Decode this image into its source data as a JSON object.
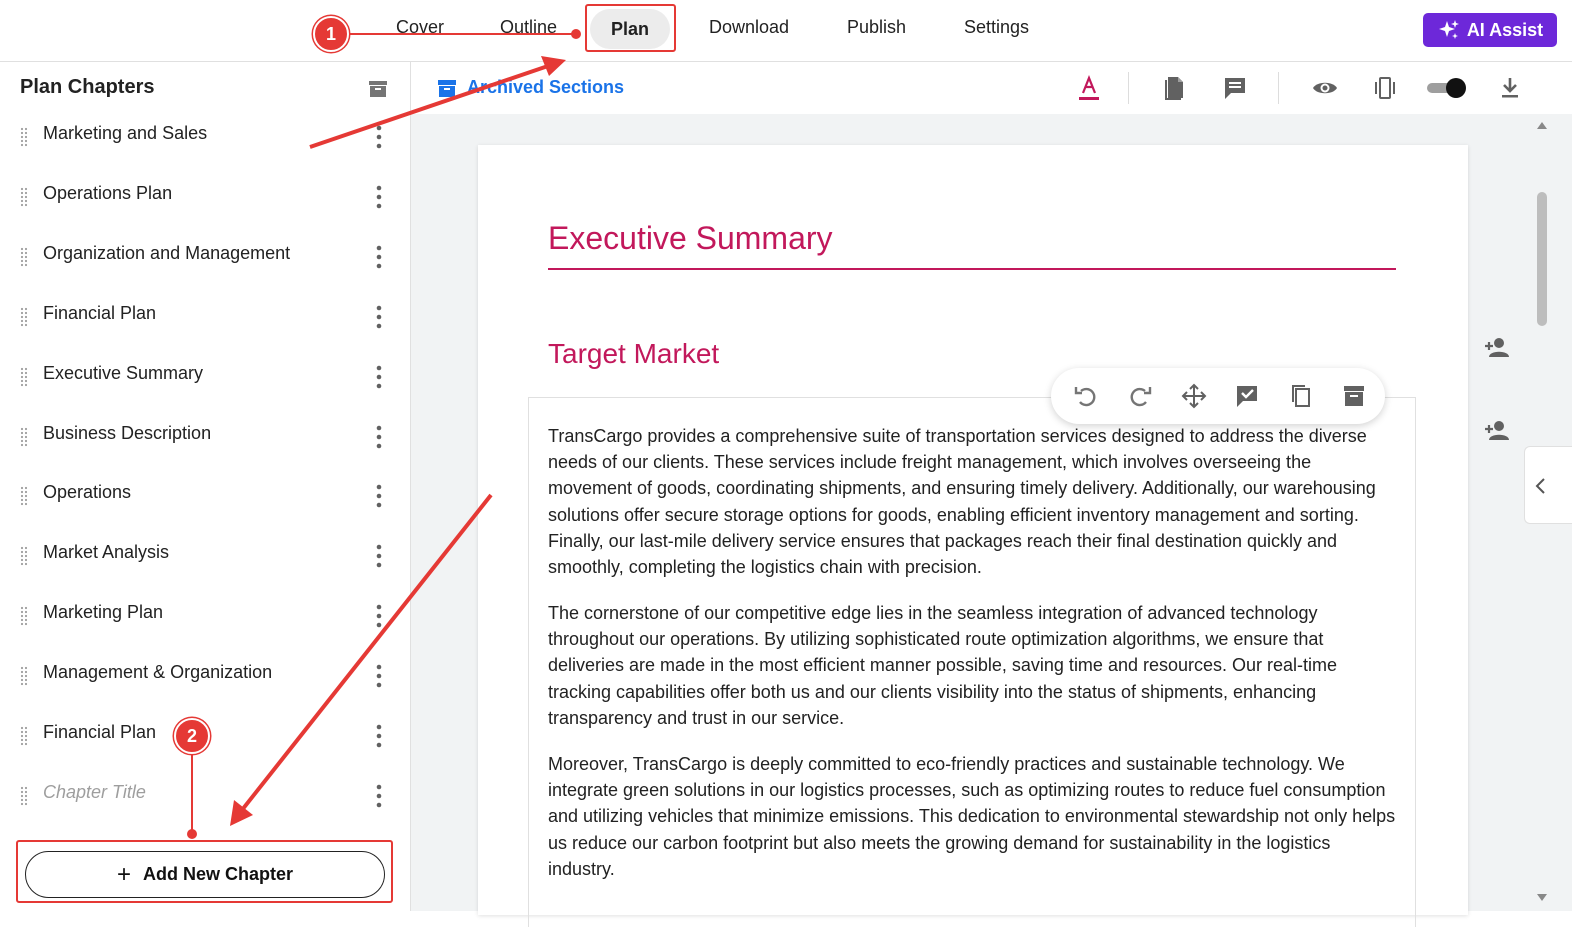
{
  "top_nav": {
    "tabs": [
      "Cover",
      "Outline",
      "Plan",
      "Download",
      "Publish",
      "Settings"
    ],
    "active_tab": "Plan",
    "ai_assist_label": "AI Assist"
  },
  "sidebar": {
    "title": "Plan Chapters",
    "chapters": [
      "Marketing and Sales",
      "Operations Plan",
      "Organization and Management",
      "Financial Plan",
      "Executive Summary",
      "Business Description",
      "Operations",
      "Market Analysis",
      "Marketing Plan",
      "Management & Organization",
      "Financial Plan"
    ],
    "new_chapter_placeholder": "Chapter Title",
    "add_chapter_label": "Add New Chapter"
  },
  "editor_toolbar": {
    "archived_sections_label": "Archived Sections"
  },
  "document": {
    "heading": "Executive Summary",
    "subheading": "Target Market",
    "paragraphs": [
      "TransCargo provides a comprehensive suite of transportation services designed to address the diverse needs of our clients. These services include freight management, which involves overseeing the movement of goods, coordinating shipments, and ensuring timely delivery. Additionally, our warehousing solutions offer secure storage options for goods, enabling efficient inventory management and sorting. Finally, our last-mile delivery service ensures that packages reach their final destination quickly and smoothly, completing the logistics chain with precision.",
      "The cornerstone of our competitive edge lies in the seamless integration of advanced technology throughout our operations. By utilizing sophisticated route optimization algorithms, we ensure that deliveries are made in the most efficient manner possible, saving time and resources. Our real-time tracking capabilities offer both us and our clients visibility into the status of shipments, enhancing transparency and trust in our service.",
      "Moreover, TransCargo is deeply committed to eco-friendly practices and sustainable technology. We integrate green solutions in our logistics processes, such as optimizing routes to reduce fuel consumption and utilizing vehicles that minimize emissions. This dedication to environmental stewardship not only helps us reduce our carbon footprint but also meets the growing demand for sustainability in the logistics industry."
    ]
  },
  "annotations": {
    "step1": "1",
    "step2": "2"
  },
  "colors": {
    "accent_pink": "#c2185b",
    "ai_purple": "#6d28d9",
    "link_blue": "#1a73e8",
    "annotation_red": "#e53935"
  }
}
